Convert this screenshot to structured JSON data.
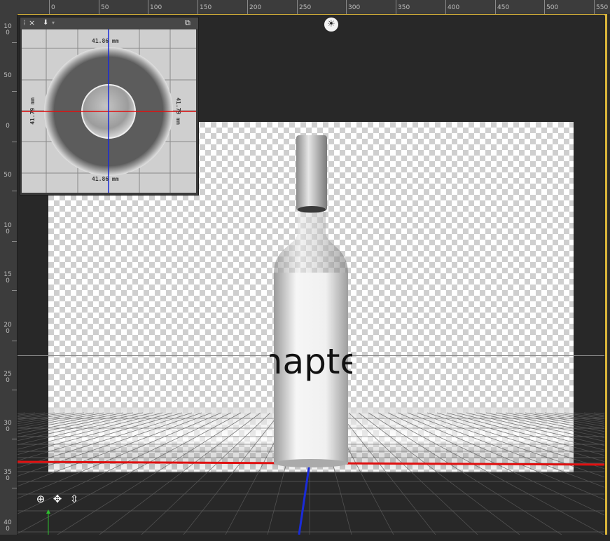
{
  "ruler": {
    "top_labels": [
      "0",
      "50",
      "100",
      "150",
      "200",
      "250",
      "300",
      "350",
      "400",
      "450",
      "500",
      "550"
    ],
    "left_labels": [
      "100",
      "50",
      "0",
      "50",
      "100",
      "150",
      "200",
      "250",
      "300",
      "350",
      "400"
    ]
  },
  "viewport": {
    "light_icon": "sun-icon",
    "label_text": "hapte",
    "nav_tools": [
      "orbit-icon",
      "pan-icon",
      "dolly-icon"
    ]
  },
  "panel": {
    "close_label": "×",
    "menu_icon": "download-icon",
    "expand_icon": "expand-icon",
    "dims": {
      "top": "41.86 mm",
      "bottom": "41.86 mm",
      "left": "41.79 mm",
      "right": "41.79 mm"
    }
  },
  "colors": {
    "accent_border": "#d9b43a",
    "axis_red": "#e01010",
    "axis_blue": "#1a2bd8",
    "axis_green": "#2ec02e"
  }
}
